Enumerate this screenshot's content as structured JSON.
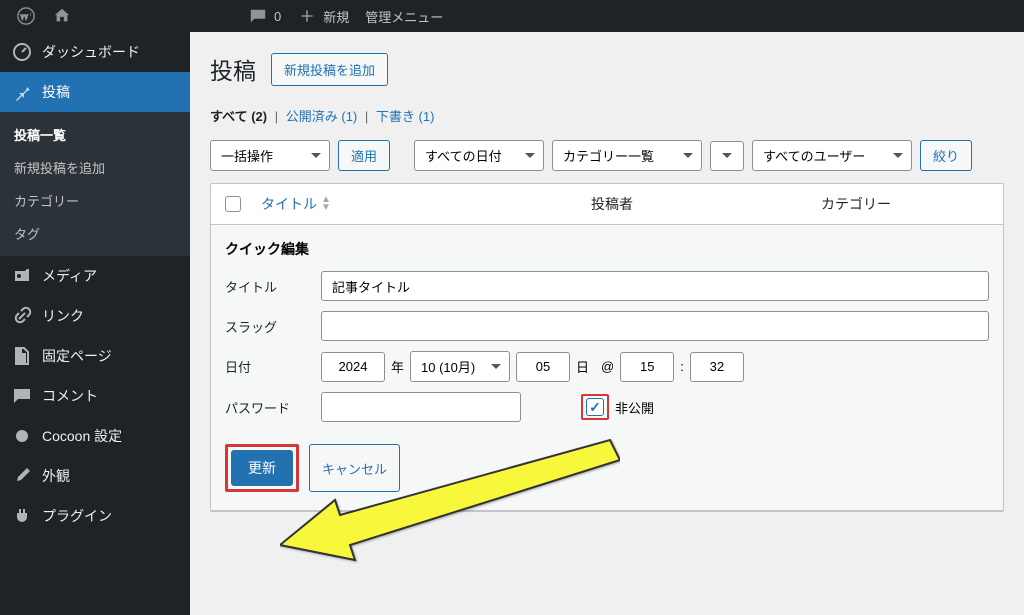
{
  "topbar": {
    "comment_count": "0",
    "new_label": "新規",
    "admin_menu_label": "管理メニュー"
  },
  "sidebar": {
    "dashboard": "ダッシュボード",
    "posts": "投稿",
    "posts_sub": {
      "list": "投稿一覧",
      "add": "新規投稿を追加",
      "categories": "カテゴリー",
      "tags": "タグ"
    },
    "media": "メディア",
    "links": "リンク",
    "pages": "固定ページ",
    "comments": "コメント",
    "cocoon": "Cocoon 設定",
    "appearance": "外観",
    "plugins": "プラグイン"
  },
  "page": {
    "title": "投稿",
    "add_button": "新規投稿を追加"
  },
  "views": {
    "all_label": "すべて",
    "all_count": "(2)",
    "published_label": "公開済み",
    "published_count": "(1)",
    "draft_label": "下書き",
    "draft_count": "(1)"
  },
  "filters": {
    "bulk_action": "一括操作",
    "apply": "適用",
    "all_dates": "すべての日付",
    "category_list": "カテゴリー一覧",
    "all_users": "すべてのユーザー",
    "filter": "絞り"
  },
  "columns": {
    "title": "タイトル",
    "author": "投稿者",
    "categories": "カテゴリー"
  },
  "quick_edit": {
    "heading": "クイック編集",
    "title_label": "タイトル",
    "title_value": "記事タイトル",
    "slug_label": "スラッグ",
    "slug_value": "",
    "date_label": "日付",
    "year": "2024",
    "year_suffix": "年",
    "month": "10 (10月)",
    "day": "05",
    "day_suffix": "日",
    "at": "@",
    "hour": "15",
    "colon": ":",
    "minute": "32",
    "password_label": "パスワード",
    "password_value": "",
    "private_label": "非公開",
    "update": "更新",
    "cancel": "キャンセル"
  }
}
